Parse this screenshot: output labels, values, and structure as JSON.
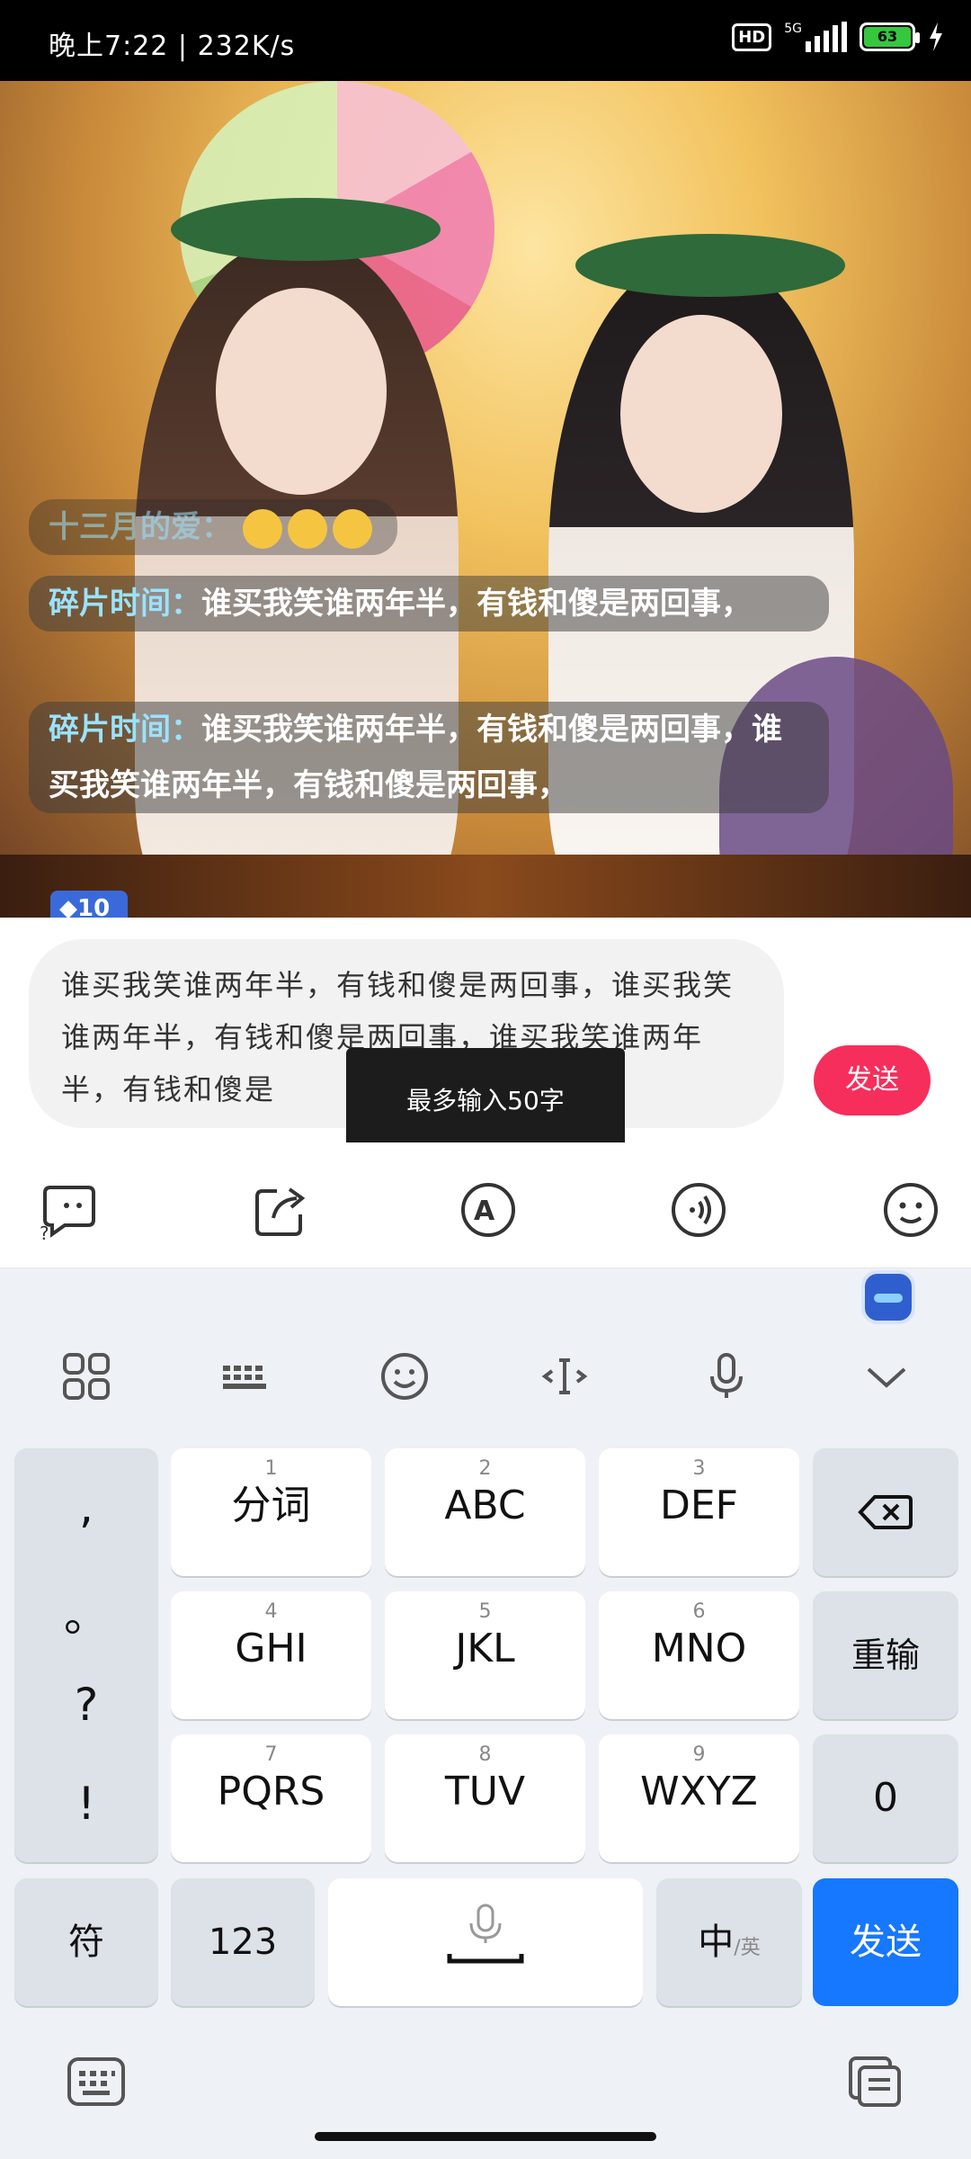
{
  "status_bar": {
    "time": "晚上7:22",
    "speed": "232K/s",
    "hd": "HD",
    "network": "5G",
    "battery": "63"
  },
  "chat": {
    "faded_user": "十三月的爱：",
    "messages": [
      {
        "user": "碎片时间：",
        "text": "谁买我笑谁两年半，有钱和傻是两回事，"
      },
      {
        "user": "碎片时间：",
        "text": "谁买我笑谁两年半，有钱和傻是两回事，谁买我笑谁两年半，有钱和傻是两回事，"
      }
    ],
    "level_badge": "10"
  },
  "input": {
    "value": "谁买我笑谁两年半，有钱和傻是两回事，谁买我笑谁两年半，有钱和傻是两回事，谁买我笑谁两年半，有钱和傻是",
    "send_label": "发送",
    "toast": "最多输入50字"
  },
  "keyboard": {
    "keys": [
      {
        "num": "1",
        "label": "分词"
      },
      {
        "num": "2",
        "label": "ABC"
      },
      {
        "num": "3",
        "label": "DEF"
      },
      {
        "num": "4",
        "label": "GHI"
      },
      {
        "num": "5",
        "label": "JKL"
      },
      {
        "num": "6",
        "label": "MNO"
      },
      {
        "num": "7",
        "label": "PQRS"
      },
      {
        "num": "8",
        "label": "TUV"
      },
      {
        "num": "9",
        "label": "WXYZ"
      }
    ],
    "punctuation": [
      ",",
      "。",
      "?",
      "!"
    ],
    "delete_icon": "backspace-icon",
    "reenter": "重输",
    "zero": "0",
    "symbols": "符",
    "numbers": "123",
    "lang_main": "中",
    "lang_alt": "/英",
    "send": "发送"
  }
}
